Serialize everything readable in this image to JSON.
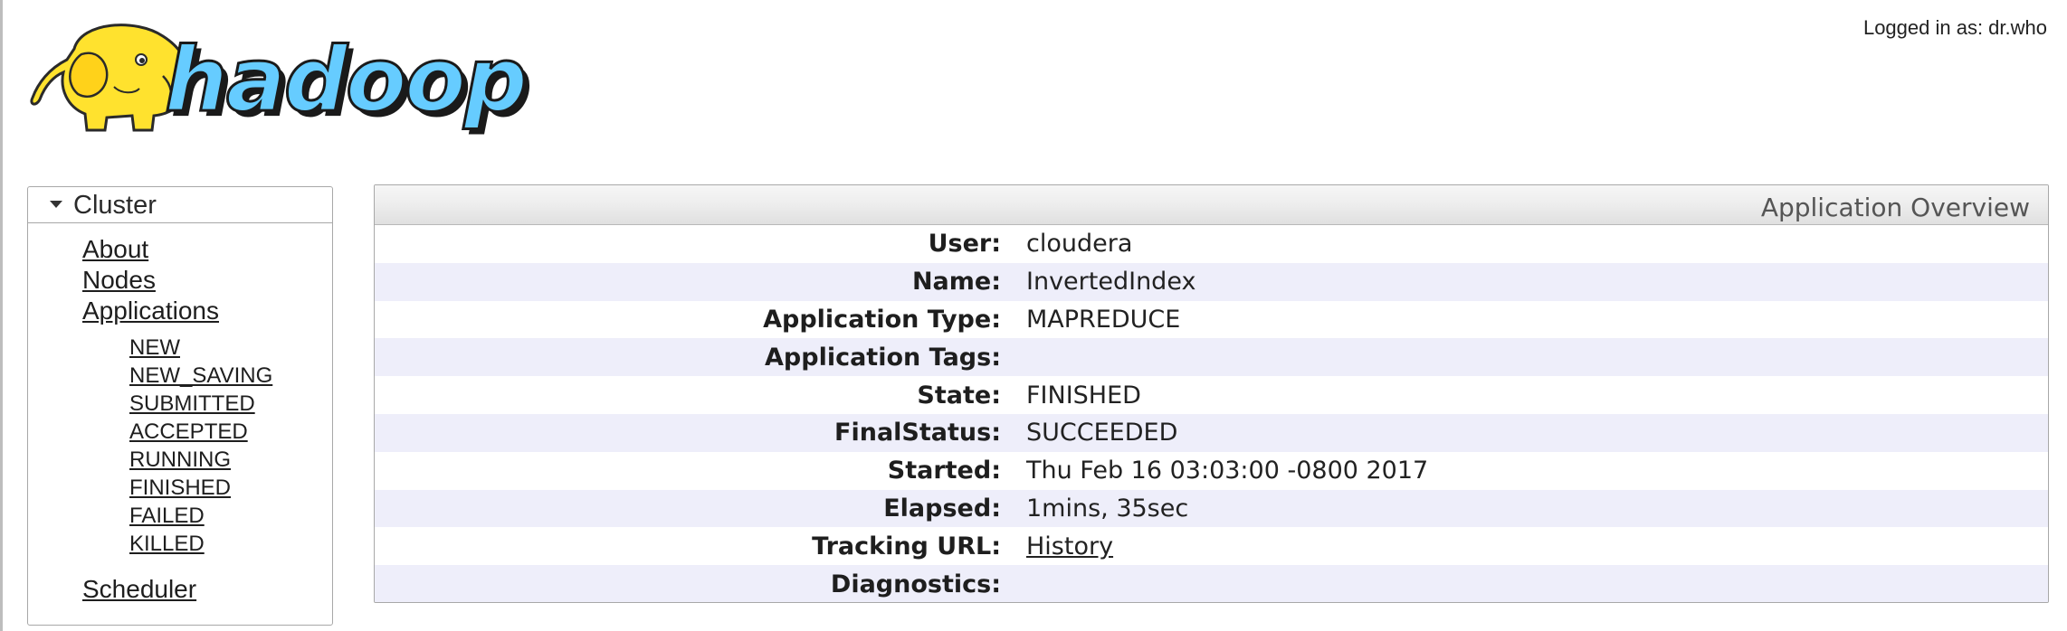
{
  "header": {
    "logo_text": "hadoop",
    "logged_in": "Logged in as: dr.who"
  },
  "sidebar": {
    "section_title": "Cluster",
    "links": [
      {
        "label": "About"
      },
      {
        "label": "Nodes"
      },
      {
        "label": "Applications"
      }
    ],
    "app_states": [
      {
        "label": "NEW"
      },
      {
        "label": "NEW_SAVING"
      },
      {
        "label": "SUBMITTED"
      },
      {
        "label": "ACCEPTED"
      },
      {
        "label": "RUNNING"
      },
      {
        "label": "FINISHED"
      },
      {
        "label": "FAILED"
      },
      {
        "label": "KILLED"
      }
    ],
    "scheduler": "Scheduler"
  },
  "overview": {
    "title": "Application Overview",
    "rows": [
      {
        "label": "User:",
        "value": "cloudera"
      },
      {
        "label": "Name:",
        "value": "InvertedIndex"
      },
      {
        "label": "Application Type:",
        "value": "MAPREDUCE"
      },
      {
        "label": "Application Tags:",
        "value": ""
      },
      {
        "label": "State:",
        "value": "FINISHED"
      },
      {
        "label": "FinalStatus:",
        "value": "SUCCEEDED"
      },
      {
        "label": "Started:",
        "value": "Thu Feb 16 03:03:00 -0800 2017"
      },
      {
        "label": "Elapsed:",
        "value": "1mins, 35sec"
      },
      {
        "label": "Tracking URL:",
        "value": "History"
      },
      {
        "label": "Diagnostics:",
        "value": ""
      }
    ]
  },
  "colors": {
    "logo_yellow": "#ffe22e",
    "logo_blue": "#66ccff",
    "row_stripe": "#eeeefa"
  }
}
